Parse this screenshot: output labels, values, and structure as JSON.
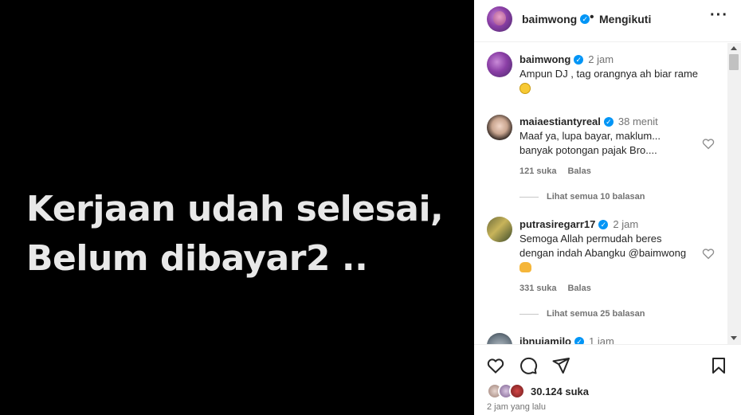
{
  "media": {
    "lines": [
      "Kerjaan udah selesai,",
      "Belum dibayar2 .."
    ]
  },
  "header": {
    "username": "baimwong",
    "separator": "•",
    "follow_label": "Mengikuti",
    "more_label": "···"
  },
  "comments": [
    {
      "username": "baimwong",
      "time": "2 jam",
      "text": "Ampun DJ , tag orangnya ah biar rame",
      "emoji": "grinning-face"
    },
    {
      "username": "maiaestiantyreal",
      "time": "38 menit",
      "text": "Maaf ya, lupa bayar, maklum... banyak potongan pajak Bro....",
      "likes": "121 suka",
      "reply_label": "Balas",
      "view_replies": "Lihat semua 10 balasan"
    },
    {
      "username": "putrasiregarr17",
      "time": "2 jam",
      "text": "Semoga Allah permudah beres dengan indah Abangku @baimwong",
      "emoji": "folded-hands",
      "likes": "331 suka",
      "reply_label": "Balas",
      "view_replies": "Lihat semua 25 balasan"
    },
    {
      "username": "ibnujamilo",
      "time": "1 jam"
    }
  ],
  "actions": {
    "icons": [
      "heart-icon",
      "comment-icon",
      "share-icon",
      "bookmark-icon"
    ]
  },
  "likes_count": "30.124 suka",
  "posted_time": "2 jam yang lalu",
  "colors": {
    "verified": "#0095f6",
    "text": "#262626",
    "muted": "#737373",
    "media_bg": "#000000",
    "media_text": "#e8e8e8"
  }
}
